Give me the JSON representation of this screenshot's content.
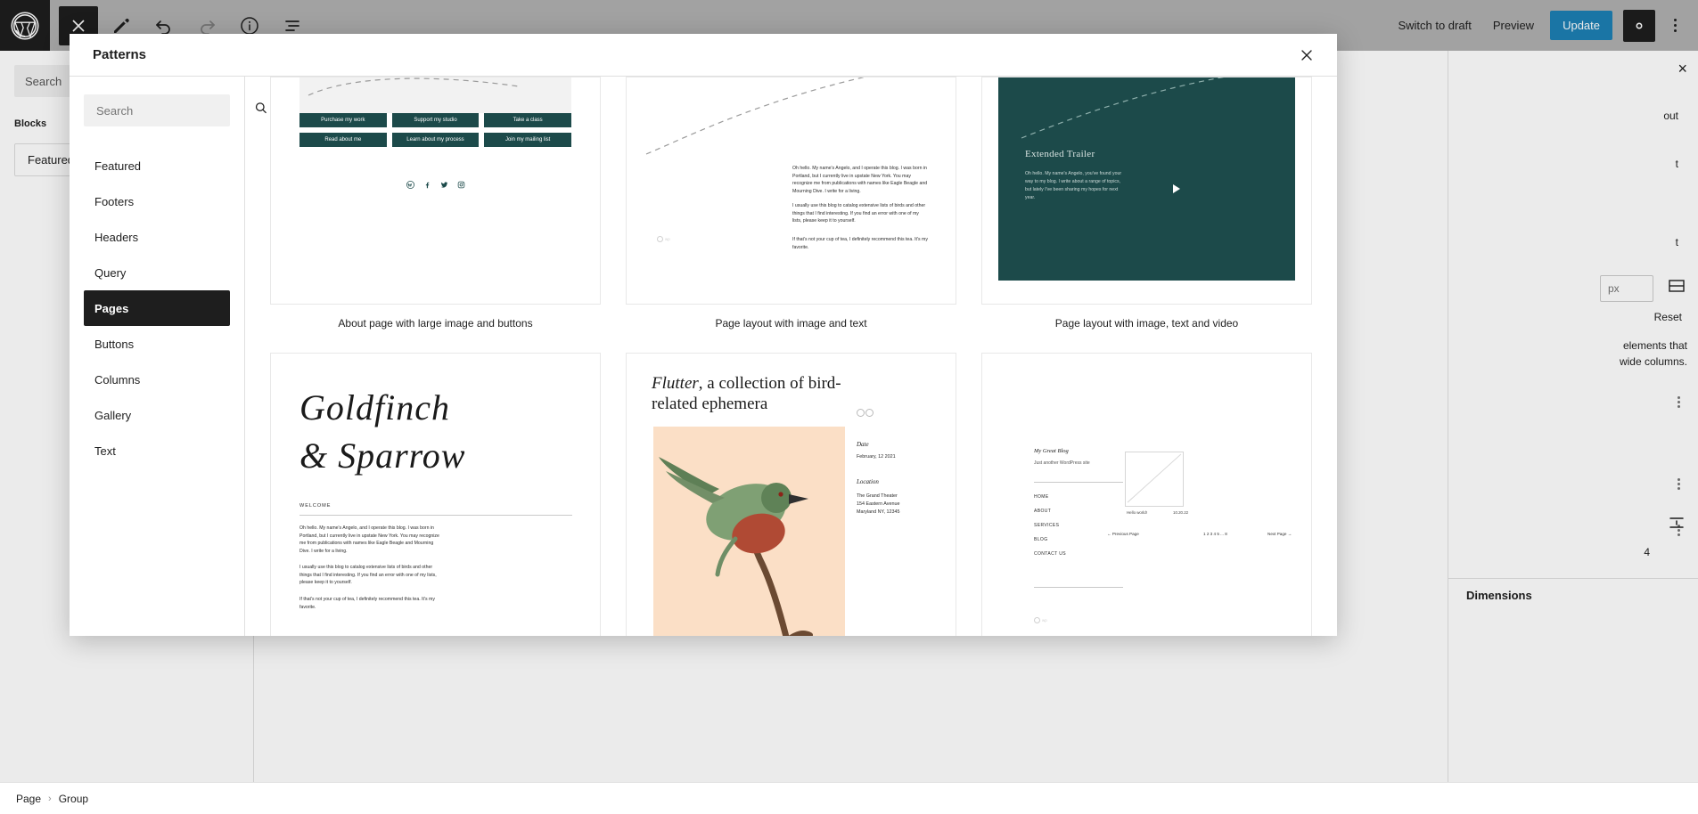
{
  "toolbar": {
    "logo_name": "wordpress-logo",
    "close_label": "×",
    "switch_to_draft": "Switch to draft",
    "preview": "Preview",
    "update": "Update",
    "accent_blue": "#1d7fb3",
    "dark": "#1e1e1e"
  },
  "left_panel": {
    "search_placeholder": "Search",
    "blocks_heading": "Blocks",
    "featured_chip": "Featured"
  },
  "modal": {
    "title": "Patterns",
    "close_label": "Close",
    "search_placeholder": "Search",
    "categories": [
      {
        "label": "Featured",
        "active": false
      },
      {
        "label": "Footers",
        "active": false
      },
      {
        "label": "Headers",
        "active": false
      },
      {
        "label": "Query",
        "active": false
      },
      {
        "label": "Pages",
        "active": true
      },
      {
        "label": "Buttons",
        "active": false
      },
      {
        "label": "Columns",
        "active": false
      },
      {
        "label": "Gallery",
        "active": false
      },
      {
        "label": "Text",
        "active": false
      }
    ],
    "patterns": [
      {
        "label": "About page with large image and buttons"
      },
      {
        "label": "Page layout with image and text"
      },
      {
        "label": "Page layout with image, text and video"
      },
      {
        "label": ""
      },
      {
        "label": ""
      },
      {
        "label": ""
      }
    ]
  },
  "pattern_content": {
    "buttons_pattern": {
      "buttons": [
        "Purchase my work",
        "Support my studio",
        "Take a class",
        "Read about me",
        "Learn about my process",
        "Join my mailing list"
      ],
      "social_icons": [
        "wordpress-icon",
        "facebook-icon",
        "twitter-icon",
        "instagram-icon"
      ],
      "accent": "#1c4a4a"
    },
    "text_pattern": {
      "paragraph_1": "Oh hello. My name's Angelo, and I operate this blog. I was born in Portland, but I currently live in upstate New York. You may recognize me from publications with names like Eagle Beagle and Mourning Dive. I write for a living.",
      "paragraph_2": "I usually use this blog to catalog extensive lists of birds and other things that I find interesting. If you find an error with one of my lists, please keep it to yourself.",
      "paragraph_3": "If that's not your cup of tea, I definitely recommend this tea. It's my favorite."
    },
    "video_pattern": {
      "heading": "Extended Trailer",
      "paragraph": "Oh hello. My name's Angelo, you've found your way to my blog. I write about a range of topics, but lately I've been sharing my hopes for next year.",
      "background": "#1c4a4a",
      "play_icon": "play-icon"
    },
    "goldfinch_pattern": {
      "heading_line_1": "Goldfinch",
      "heading_line_2": "& Sparrow",
      "eyebrow": "WELCOME",
      "paragraph_1": "Oh hello. My name's Angelo, and I operate this blog. I was born in Portland, but I currently live in upstate New York. You may recognize me from publications with names like Eagle Beagle and Mourning Dive. I write for a living.",
      "paragraph_2": "I usually use this blog to catalog extensive lists of birds and other things that I find interesting. If you find an error with one of my lists, please keep it to yourself.",
      "paragraph_3": "If that's not your cup of tea, I definitely recommend this tea. It's my favorite."
    },
    "flutter_pattern": {
      "heading_italic": "Flutter",
      "heading_rest": ", a collection of bird-related ephemera",
      "date_label": "Date",
      "date_value": "February, 12 2021",
      "location_label": "Location",
      "location_line_1": "The Grand Theater",
      "location_line_2": "154 Eastern Avenue",
      "location_line_3": "Maryland NY, 12345",
      "image_bg": "#fbdfc6",
      "glasses_icon": "glasses-icon"
    },
    "blog_pattern": {
      "site_title": "My Great Blog",
      "tagline": "Just another WordPress site",
      "nav": [
        "HOME",
        "ABOUT",
        "SERVICES",
        "BLOG",
        "CONTACT US"
      ],
      "post_title": "Hello world!",
      "post_date": "10.20.22",
      "prev_label": "← Previous Page",
      "pagination": "1 2 3 4 5 ... 8",
      "next_label": "Next Page →"
    }
  },
  "right_panel": {
    "close_label": "×",
    "unit_px": "px",
    "reset_label": "Reset",
    "help_text_1": "elements that",
    "help_text_2": "wide columns.",
    "dimensions_title": "Dimensions",
    "value_4": "4"
  },
  "breadcrumb": {
    "items": [
      "Page",
      "Group"
    ],
    "separator": "›"
  }
}
